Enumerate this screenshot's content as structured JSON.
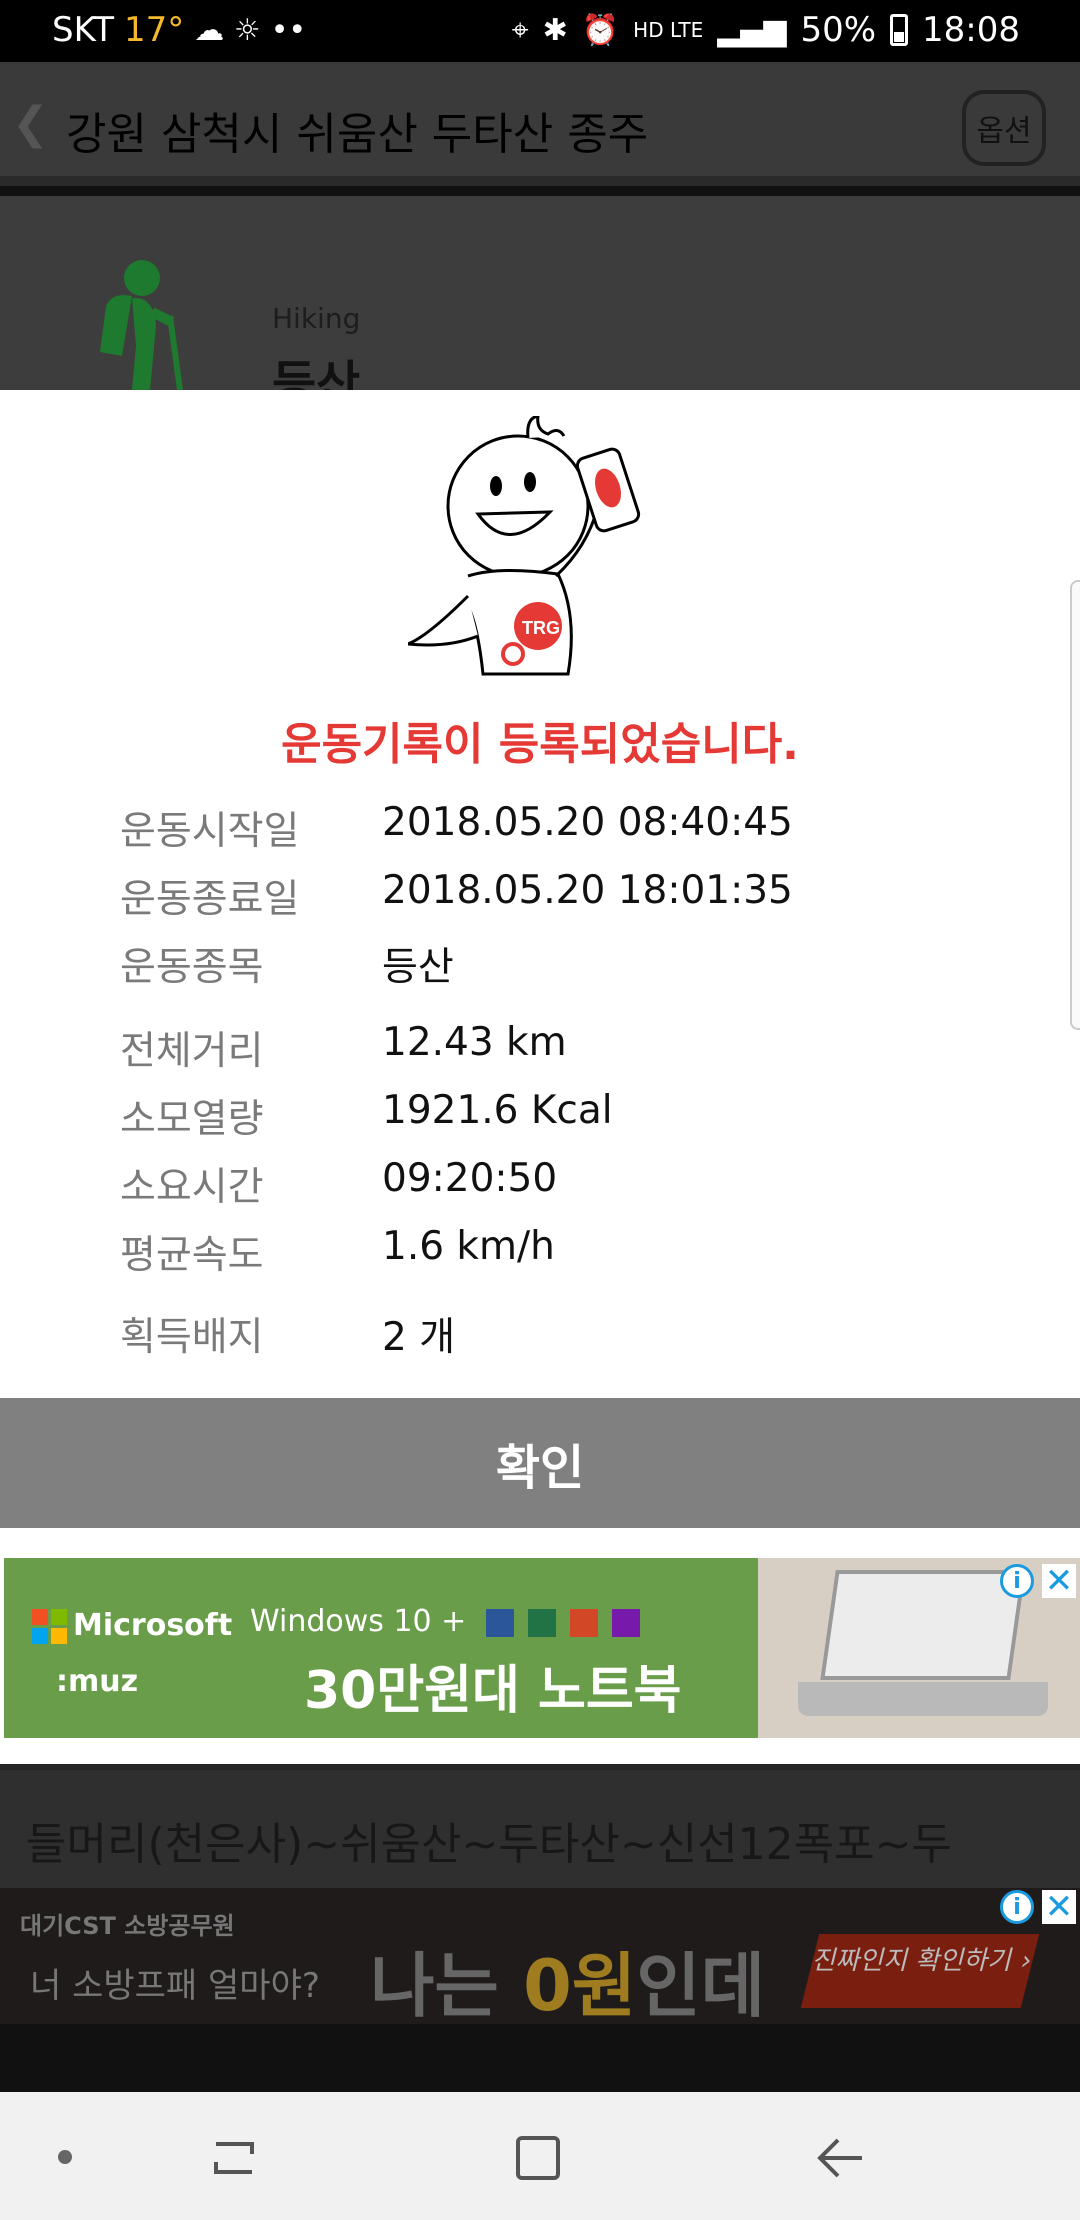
{
  "status_bar": {
    "carrier": "SKT",
    "temperature": "17°",
    "weather_icons": "☁ ☼",
    "dots": "••",
    "network": "HD LTE",
    "battery": "50%",
    "time": "18:08"
  },
  "app_bar": {
    "back_icon": "❮",
    "title": "강원 삼척시 쉬움산 두타산 종주",
    "option_label": "옵션"
  },
  "activity": {
    "label_en": "Hiking",
    "label_kr": "등산"
  },
  "dialog": {
    "mascot_badge": "TRG",
    "title": "운동기록이 등록되었습니다.",
    "rows": [
      {
        "label": "운동시작일",
        "value": "2018.05.20 08:40:45"
      },
      {
        "label": "운동종료일",
        "value": "2018.05.20 18:01:35"
      },
      {
        "label": "운동종목",
        "value": "등산"
      },
      {
        "label": "전체거리",
        "value": "12.43 km"
      },
      {
        "label": "소모열량",
        "value": "1921.6 Kcal"
      },
      {
        "label": "소요시간",
        "value": "09:20:50"
      },
      {
        "label": "평균속도",
        "value": "1.6 km/h"
      },
      {
        "label": "획득배지",
        "value": "2 개"
      }
    ],
    "confirm_label": "확인"
  },
  "ad1": {
    "brand": "Microsoft",
    "sub_brand": ":muz",
    "windows": "Windows 10 +",
    "headline": "30만원대 노트북",
    "info_icon": "i",
    "close_icon": "✕"
  },
  "route_text": "들머리(천은사)~쉬움산~두타산~신선12폭포~두",
  "ad2": {
    "brand": "대기CST 소방공무원",
    "question": "너 소방프패 얼마야?",
    "headline_pre": "나는 ",
    "headline_accent": "0원",
    "headline_post": "인데",
    "cta": "진짜인지 확인하기 ›",
    "info_icon": "i",
    "close_icon": "✕"
  },
  "colors": {
    "title_red": "#e53935",
    "confirm_button": "#808080",
    "ad_green": "#6a9d4a"
  }
}
